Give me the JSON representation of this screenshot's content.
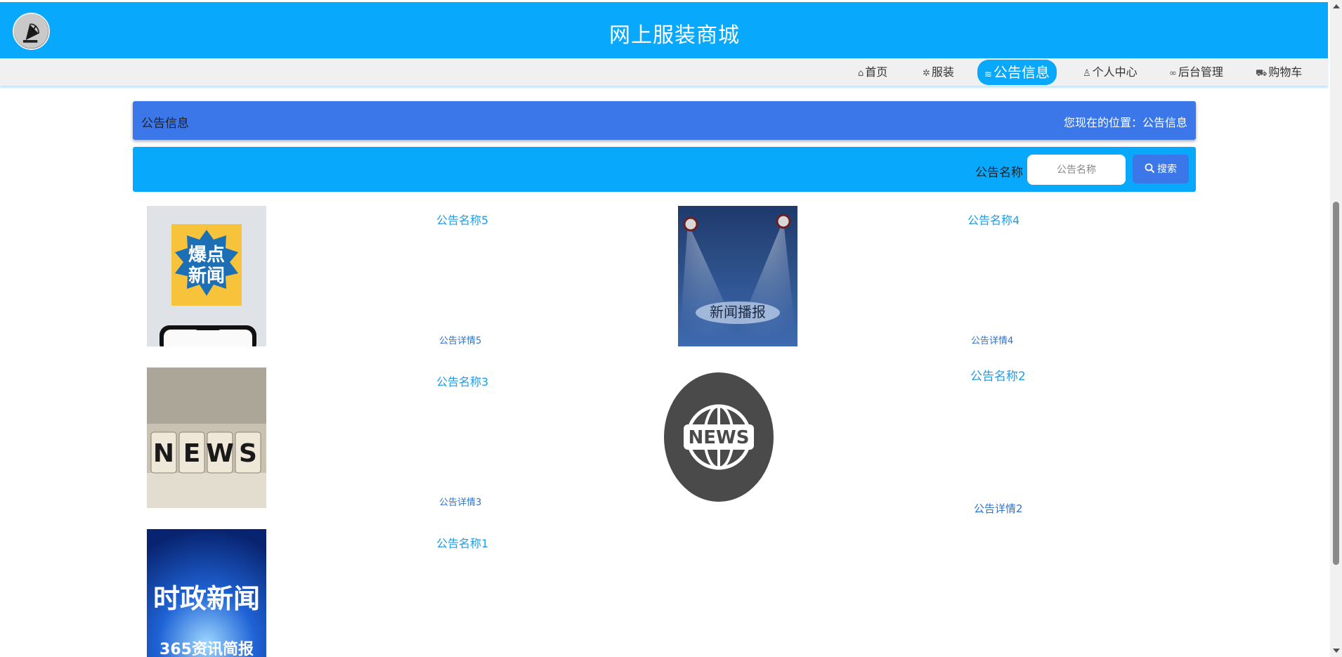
{
  "header": {
    "site_title": "网上服装商城",
    "logo_icon": "satellite-dish-icon"
  },
  "nav": {
    "items": [
      {
        "label": "首页",
        "icon": "home-icon",
        "glyph": "⌂"
      },
      {
        "label": "服装",
        "icon": "gear-icon",
        "glyph": "✲"
      },
      {
        "label": "公告信息",
        "icon": "layers-icon",
        "glyph": "≋",
        "active": true
      },
      {
        "label": "个人中心",
        "icon": "user-icon",
        "glyph": "♙"
      },
      {
        "label": "后台管理",
        "icon": "link-icon",
        "glyph": "∞"
      },
      {
        "label": "购物车",
        "icon": "cart-icon",
        "glyph": "⛟"
      }
    ]
  },
  "breadcrumb": {
    "title": "公告信息",
    "position": "您现在的位置：公告信息"
  },
  "search": {
    "label": "公告名称",
    "placeholder": "公告名称",
    "button_label": "搜索"
  },
  "news": [
    {
      "title": "公告名称5",
      "detail": "公告详情5",
      "image": "explosive-news-poster",
      "image_text": [
        "爆点",
        "新闻"
      ]
    },
    {
      "title": "公告名称4",
      "detail": "公告详情4",
      "image": "news-broadcast-stage",
      "image_text": [
        "新闻播报"
      ]
    },
    {
      "title": "公告名称3",
      "detail": "公告详情3",
      "image": "news-letter-blocks",
      "image_text": [
        "N",
        "E",
        "W",
        "S"
      ]
    },
    {
      "title": "公告名称2",
      "detail": "公告详情2",
      "image": "globe-news-icon",
      "image_text": [
        "NEWS"
      ]
    },
    {
      "title": "公告名称1",
      "detail": "",
      "image": "political-news-poster",
      "image_text": [
        "时政新闻",
        "365资讯简报"
      ]
    }
  ],
  "colors": {
    "header_blue": "#08a8fc",
    "crumb_blue": "#3b77e9",
    "link_blue": "#1e9ee8"
  }
}
